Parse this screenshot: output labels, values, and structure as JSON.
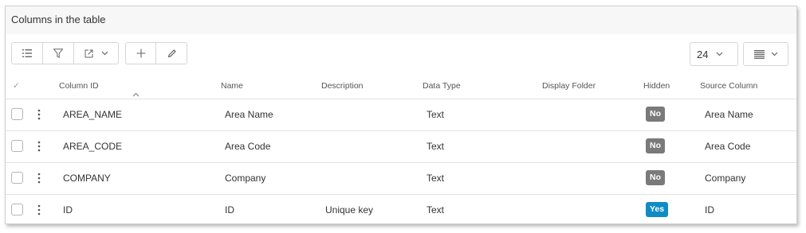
{
  "panel": {
    "title": "Columns in the table"
  },
  "toolbar": {
    "page_size": "24",
    "buttons": [
      "list-icon",
      "filter-icon",
      "export-icon",
      "add-icon",
      "edit-icon",
      "view-icon"
    ]
  },
  "table": {
    "headers": {
      "select": "✓",
      "column_id": "Column ID",
      "name": "Name",
      "description": "Description",
      "data_type": "Data Type",
      "display_folder": "Display Folder",
      "hidden": "Hidden",
      "source_column": "Source Column"
    },
    "rows": [
      {
        "column_id": "AREA_NAME",
        "name": "Area Name",
        "description": "",
        "data_type": "Text",
        "display_folder": "",
        "hidden": "No",
        "source_column": "Area Name"
      },
      {
        "column_id": "AREA_CODE",
        "name": "Area Code",
        "description": "",
        "data_type": "Text",
        "display_folder": "",
        "hidden": "No",
        "source_column": "Area Code"
      },
      {
        "column_id": "COMPANY",
        "name": "Company",
        "description": "",
        "data_type": "Text",
        "display_folder": "",
        "hidden": "No",
        "source_column": "Company"
      },
      {
        "column_id": "ID",
        "name": "ID",
        "description": "Unique key",
        "data_type": "Text",
        "display_folder": "",
        "hidden": "Yes",
        "source_column": "ID"
      }
    ]
  },
  "colors": {
    "badge_no": "#7a7a7a",
    "badge_yes": "#0f8cc4"
  }
}
